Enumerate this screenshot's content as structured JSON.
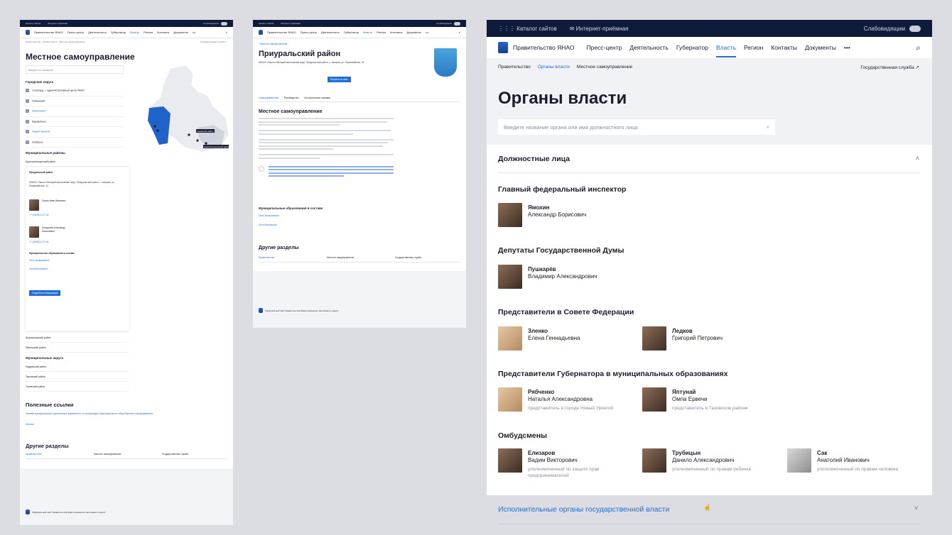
{
  "common": {
    "catalog": "Каталог сайтов",
    "reception": "Интернет-приёмная",
    "visually_impaired": "Слабовидящим",
    "site_name": "Правительство ЯНАО",
    "nav": [
      "Пресс-центр",
      "Деятельность",
      "Губернатор",
      "Власть",
      "Регион",
      "Контакты",
      "Документы"
    ],
    "more": "•••",
    "civil_service": "Государственная служба ↗"
  },
  "frame_a": {
    "title": "Местное самоуправление",
    "search_placeholder": "Введите по названию",
    "urban_heading": "Городские округа",
    "urban": [
      "Салехард — административный центр ЯНАО",
      "Губкинский",
      "Лабытнанги",
      "Муравленко",
      "Новый Уренгой",
      "Ноябрьск"
    ],
    "districts_heading": "Муниципальные районы",
    "districts": [
      "Красноселькупский район",
      "Приуральский район"
    ],
    "expanded_address": "629620, Ямало-Ненецкий автономный округ, Приуральский район, с. Аксарка, ул. Первомайская, 24",
    "person_1_name": "Смоян Иван Иванович",
    "person_2_name": "Алхадзиев Александр Николаевич",
    "phone": "+7 (34993) 2-27-44",
    "mo_heading": "Муниципальные образования в составе",
    "mo_links": [
      "Село Аксарковское",
      "Село Белоярское"
    ],
    "more_button": "Подробная информация",
    "districts_more": [
      "Шурышкарский район",
      "Ямальский район"
    ],
    "municipal_heading": "Муниципальные округа",
    "municipal": [
      "Надымский район",
      "Пуровский район",
      "Тазовский район"
    ],
    "useful_heading": "Полезные ссылки",
    "useful_link": "Типовой муниципальный нормативный правовой акт по организации территориального общественного самоуправления",
    "useful_link_2": "Опросы",
    "other_heading": "Другие разделы",
    "other": [
      "Правительство",
      "Местное самоуправление",
      "Государственная служба"
    ],
    "map_labels": [
      "Тазовский район",
      "Красноселькупский район"
    ]
  },
  "frame_b": {
    "breadcrumb": "Местное самоуправление",
    "title": "Приуральский район",
    "address": "629620, Ямало-Ненецкий автономный округ, Приуральский район, с. Аксарка, ул. Первомайская, 24",
    "tabs": [
      "Самоуправление",
      "Руководство",
      "Историческая справка"
    ],
    "section_title": "Местное самоуправление",
    "mo_heading": "Муниципальные образования в составе",
    "mo_links": [
      "Село Аксарковское",
      "Село Белоярское"
    ],
    "other_heading": "Другие разделы",
    "other": [
      "Правительство",
      "Местное самоуправление",
      "Государственная служба"
    ],
    "go_button": "Перейти на сайт",
    "footer_site": "Официальный сайт Правительства Ямало-Ненецкого автономного округа"
  },
  "frame_c": {
    "crumbs": [
      "Правительство",
      "Органы власти",
      "Местное самоуправление"
    ],
    "title": "Органы власти",
    "search_placeholder": "Введите название органа или имя должностного лица",
    "officials_heading": "Должностные лица",
    "sections": [
      "Главный федеральный инспектор",
      "Депутаты Государственной Думы",
      "Представители в Совете Федерации",
      "Представители Губернатора в муниципальных образованиях",
      "Омбудсмены"
    ],
    "people": [
      {
        "last": "Ямохин",
        "first": "Александр Борисович",
        "note": ""
      },
      {
        "last": "Пушкарёв",
        "first": "Владимир Александрович",
        "note": ""
      },
      {
        "last": "Зленко",
        "first": "Елена Геннадьевна",
        "note": ""
      },
      {
        "last": "Ледков",
        "first": "Григорий Петрович",
        "note": ""
      },
      {
        "last": "Рябченко",
        "first": "Наталья Александровна",
        "note": "представитель в городе Новый Уренгой"
      },
      {
        "last": "Яптунай",
        "first": "Омпа Ервечи",
        "note": "представитель в Тазовском районе"
      },
      {
        "last": "Елизаров",
        "first": "Вадим Викторович",
        "note": "уполномоченный по защите прав предпринимателей"
      },
      {
        "last": "Трубицын",
        "first": "Данило Александрович",
        "note": "уполномоченный по правам ребенка"
      },
      {
        "last": "Сак",
        "first": "Анатолий Иванович",
        "note": "уполномоченный по правам человека"
      }
    ],
    "executive_heading": "Исполнительные органы государственной власти"
  },
  "colors": {
    "navy": "#0f1b3a",
    "accent": "#1f6fd6",
    "map_blue": "#1f62c8"
  }
}
